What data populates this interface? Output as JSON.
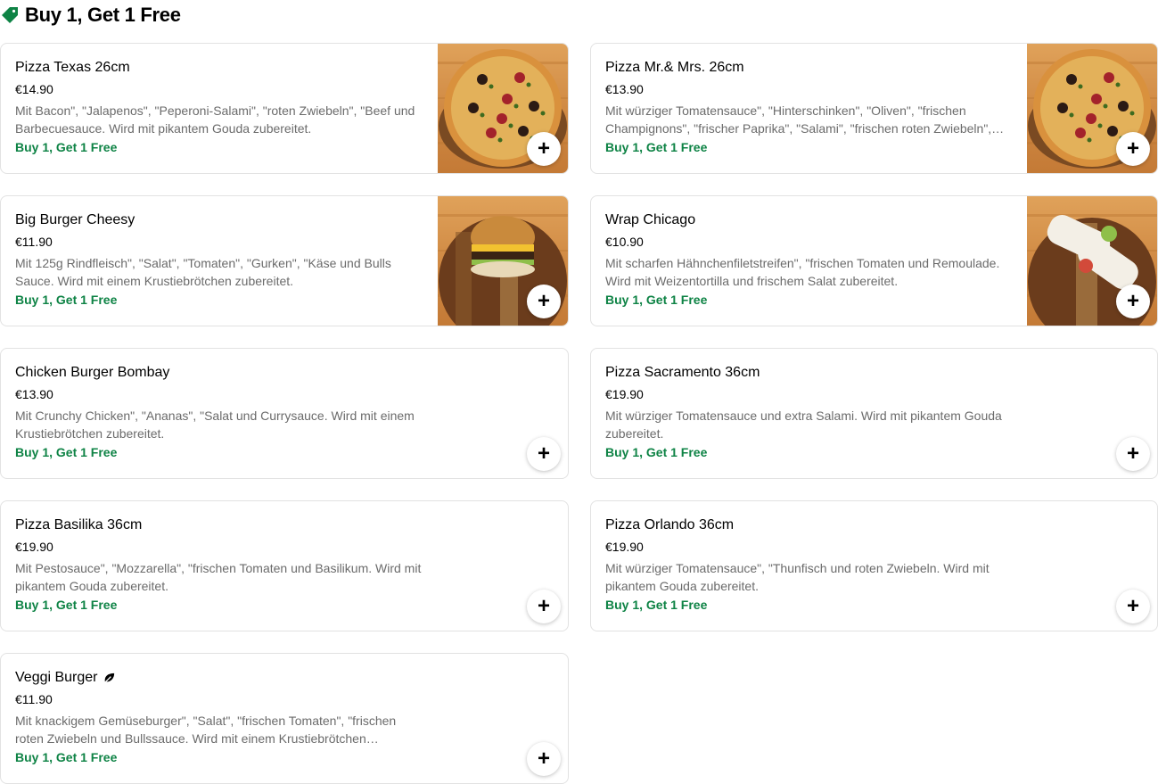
{
  "section": {
    "title": "Buy 1, Get 1 Free",
    "icon": "tag-icon",
    "accent": "#0e8345"
  },
  "items": [
    {
      "name": "Pizza Texas 26cm",
      "price": "€14.90",
      "description": "Mit Bacon\", \"Jalapenos\", \"Peperoni-Salami\", \"roten Zwiebeln\", \"Beef und Barbecuesauce. Wird mit pikantem Gouda zubereitet.",
      "promo": "Buy 1, Get 1 Free",
      "add_label": "+",
      "image": "pizza"
    },
    {
      "name": "Pizza Mr.& Mrs. 26cm",
      "price": "€13.90",
      "description": "Mit würziger Tomatensauce\", \"Hinterschinken\", \"Oliven\", \"frischen Champignons\", \"frischer Paprika\", \"Salami\", \"frischen roten Zwiebeln\",…",
      "promo": "Buy 1, Get 1 Free",
      "add_label": "+",
      "image": "pizza"
    },
    {
      "name": "Big Burger Cheesy",
      "price": "€11.90",
      "description": "Mit 125g Rindfleisch\", \"Salat\", \"Tomaten\", \"Gurken\", \"Käse und Bulls Sauce. Wird mit einem Krustiebrötchen zubereitet.",
      "promo": "Buy 1, Get 1 Free",
      "add_label": "+",
      "image": "burger"
    },
    {
      "name": "Wrap Chicago",
      "price": "€10.90",
      "description": "Mit scharfen Hähnchenfiletstreifen\", \"frischen Tomaten und Remoulade. Wird mit Weizentortilla und frischem Salat zubereitet.",
      "promo": "Buy 1, Get 1 Free",
      "add_label": "+",
      "image": "wrap"
    },
    {
      "name": "Chicken Burger Bombay",
      "price": "€13.90",
      "description": "Mit Crunchy Chicken\", \"Ananas\", \"Salat und Currysauce. Wird mit einem Krustiebrötchen zubereitet.",
      "promo": "Buy 1, Get 1 Free",
      "add_label": "+",
      "image": ""
    },
    {
      "name": "Pizza Sacramento 36cm",
      "price": "€19.90",
      "description": "Mit würziger Tomatensauce und extra Salami. Wird mit pikantem Gouda zubereitet.",
      "promo": "Buy 1, Get 1 Free",
      "add_label": "+",
      "image": ""
    },
    {
      "name": "Pizza Basilika 36cm",
      "price": "€19.90",
      "description": "Mit Pestosauce\", \"Mozzarella\", \"frischen Tomaten und Basilikum. Wird mit pikantem Gouda zubereitet.",
      "promo": "Buy 1, Get 1 Free",
      "add_label": "+",
      "image": ""
    },
    {
      "name": "Pizza Orlando 36cm",
      "price": "€19.90",
      "description": "Mit würziger Tomatensauce\", \"Thunfisch und roten Zwiebeln. Wird mit pikantem Gouda zubereitet.",
      "promo": "Buy 1, Get 1 Free",
      "add_label": "+",
      "image": ""
    },
    {
      "name": "Veggi Burger",
      "name_icon": "leaf-icon",
      "price": "€11.90",
      "description": "Mit knackigem Gemüseburger\", \"Salat\", \"frischen Tomaten\", \"frischen roten Zwiebeln und Bullssauce. Wird mit einem Krustiebrötchen…",
      "promo": "Buy 1, Get 1 Free",
      "add_label": "+",
      "image": ""
    }
  ]
}
